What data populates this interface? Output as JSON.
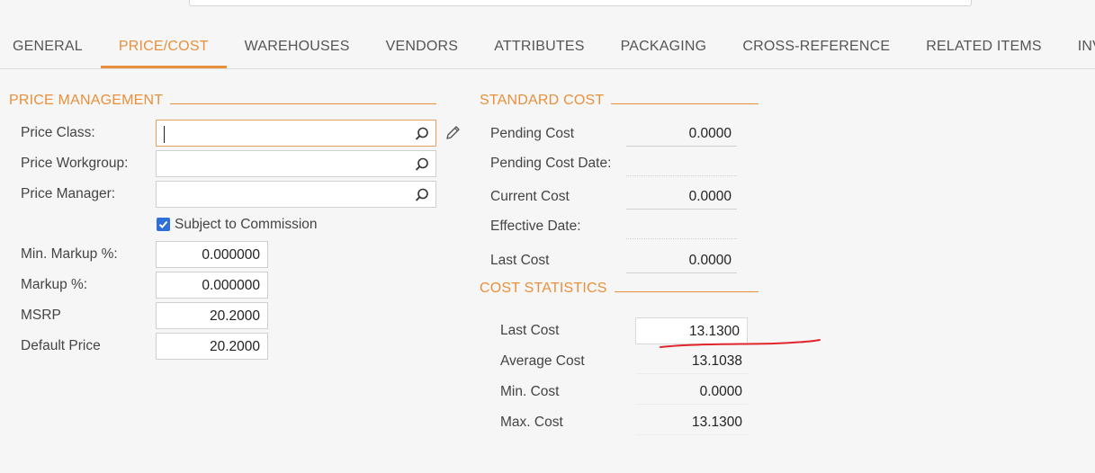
{
  "tabs": [
    {
      "label": "GENERAL"
    },
    {
      "label": "PRICE/COST"
    },
    {
      "label": "WAREHOUSES"
    },
    {
      "label": "VENDORS"
    },
    {
      "label": "ATTRIBUTES"
    },
    {
      "label": "PACKAGING"
    },
    {
      "label": "CROSS-REFERENCE"
    },
    {
      "label": "RELATED ITEMS"
    },
    {
      "label": "INV"
    }
  ],
  "active_tab": "PRICE/COST",
  "accent_color": "#e8903c",
  "price_management": {
    "title": "PRICE MANAGEMENT",
    "price_class": {
      "label": "Price Class:",
      "value": ""
    },
    "price_workgroup": {
      "label": "Price Workgroup:",
      "value": ""
    },
    "price_manager": {
      "label": "Price Manager:",
      "value": ""
    },
    "subject_to_commission": {
      "label": "Subject to Commission",
      "checked": true
    },
    "min_markup": {
      "label": "Min. Markup %:",
      "value": "0.000000"
    },
    "markup": {
      "label": "Markup %:",
      "value": "0.000000"
    },
    "msrp": {
      "label": "MSRP",
      "value": "20.2000"
    },
    "default_price": {
      "label": "Default Price",
      "value": "20.2000"
    }
  },
  "standard_cost": {
    "title": "STANDARD COST",
    "pending_cost": {
      "label": "Pending Cost",
      "value": "0.0000"
    },
    "pending_cost_date": {
      "label": "Pending Cost Date:",
      "value": ""
    },
    "current_cost": {
      "label": "Current Cost",
      "value": "0.0000"
    },
    "effective_date": {
      "label": "Effective Date:",
      "value": ""
    },
    "last_cost": {
      "label": "Last Cost",
      "value": "0.0000"
    }
  },
  "cost_statistics": {
    "title": "COST STATISTICS",
    "last_cost": {
      "label": "Last Cost",
      "value": "13.1300"
    },
    "average_cost": {
      "label": "Average Cost",
      "value": "13.1038"
    },
    "min_cost": {
      "label": "Min. Cost",
      "value": "0.0000"
    },
    "max_cost": {
      "label": "Max. Cost",
      "value": "13.1300"
    }
  }
}
